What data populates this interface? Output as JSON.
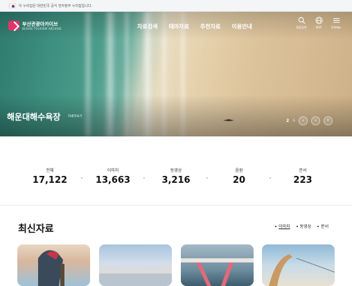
{
  "gov_bar": {
    "text": "이 누리집은 대한민국 공식 전자정부 누리집입니다."
  },
  "logo": {
    "name": "부산관광아카이브",
    "name_en": "BUSAN TOURISM ARCHIVE"
  },
  "gnb": {
    "items": [
      "자료검색",
      "테마자료",
      "추천자료",
      "이용안내"
    ]
  },
  "utility": {
    "search": "통합검색",
    "language": "KOR",
    "menu": "전체메뉴"
  },
  "hero": {
    "title": "해운대해수욕장",
    "more_label": "자세히보기",
    "pager_current": "2",
    "pager_total": "6",
    "prev": "‹",
    "next": "›",
    "pause": "II"
  },
  "stats": [
    {
      "label": "전체",
      "value": "17,122"
    },
    {
      "label": "이미지",
      "value": "13,663"
    },
    {
      "label": "동영상",
      "value": "3,216"
    },
    {
      "label": "음원",
      "value": "20"
    },
    {
      "label": "문서",
      "value": "223"
    }
  ],
  "latest": {
    "title": "최신자료",
    "filters": [
      "이미지",
      "동영상",
      "문서"
    ]
  },
  "colors": {
    "brand": "#e5336a"
  }
}
